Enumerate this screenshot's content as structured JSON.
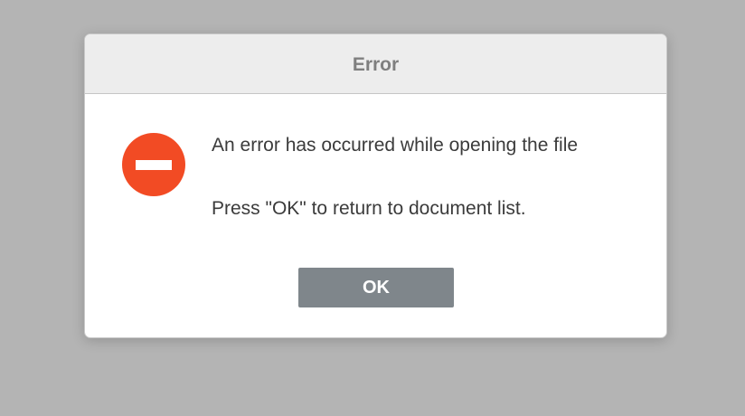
{
  "dialog": {
    "title": "Error",
    "icon": "error-stop-icon",
    "message_line1": "An error has occurred while opening the file",
    "message_line2": "Press \"OK\" to return to document list.",
    "ok_label": "OK"
  },
  "colors": {
    "backdrop": "#b4b4b4",
    "header_bg": "#ededed",
    "title_text": "#7f7f7f",
    "icon": "#f24b24",
    "button_bg": "#7f868b",
    "message_text": "#3b3b3b"
  }
}
